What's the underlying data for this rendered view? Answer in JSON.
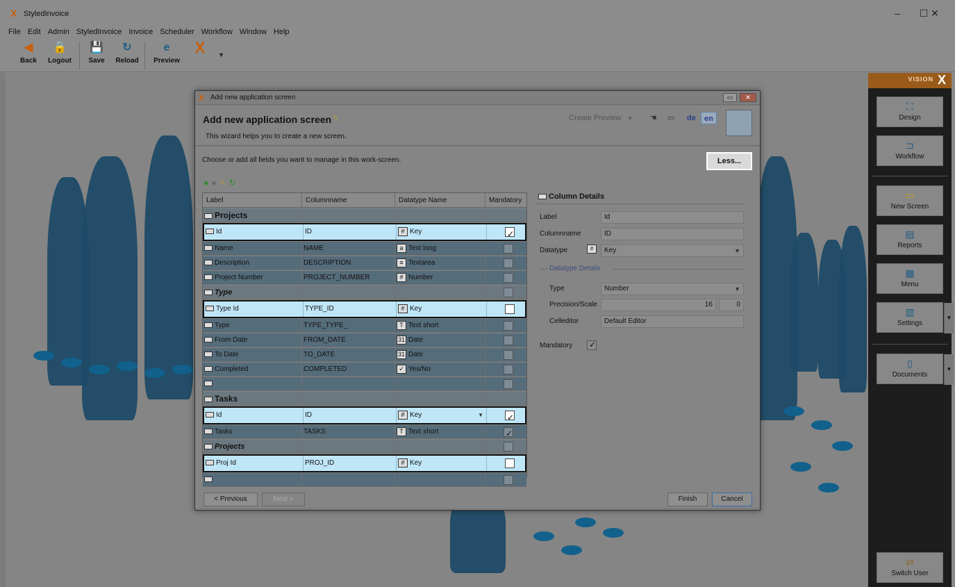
{
  "window": {
    "title": "StyledInvoice",
    "minimize": "–",
    "maximize": "☐",
    "close": "✕"
  },
  "menu": [
    "File",
    "Edit",
    "Admin",
    "StyledInvoice",
    "Invoice",
    "Scheduler",
    "Workflow",
    "Window",
    "Help"
  ],
  "toolbar": {
    "back": "Back",
    "logout": "Logout",
    "save": "Save",
    "reload": "Reload",
    "preview": "Preview"
  },
  "sidebar": {
    "brand": "VISION",
    "design": "Design",
    "workflow": "Workflow",
    "new_screen": "New Screen",
    "reports": "Reports",
    "menu": "Menu",
    "settings": "Settings",
    "documents": "Documents",
    "switch_user": "Switch User"
  },
  "dialog": {
    "window_title": "Add new application screen",
    "heading": "Add new application screen",
    "subtitle": "This wizard helps you to create a new screen.",
    "create_preview": "Create Preview",
    "lang_de": "de",
    "lang_en": "en",
    "instructions": "Choose or add all fields you want to manage in this work-screen.",
    "less_button": "Less...",
    "columns": {
      "label": "Label",
      "columnname": "Columnname",
      "datatype": "Datatype Name",
      "mandatory": "Mandatory"
    },
    "rows": [
      {
        "label": "Projects",
        "col": "",
        "dt": "",
        "dt_icon": "",
        "type": "group",
        "mand": null
      },
      {
        "label": "Id",
        "col": "ID",
        "dt": "Key",
        "dt_icon": "#",
        "type": "hl",
        "mand": true
      },
      {
        "label": "Name",
        "col": "NAME",
        "dt": "Text long",
        "dt_icon": "a",
        "type": "row",
        "mand": false
      },
      {
        "label": "Description",
        "col": "DESCRIPTION",
        "dt": "Textarea",
        "dt_icon": "≡",
        "type": "row",
        "mand": false
      },
      {
        "label": "Project Number",
        "col": "PROJECT_NUMBER",
        "dt": "Number",
        "dt_icon": "#",
        "type": "row",
        "mand": false
      },
      {
        "label": "Type",
        "col": "",
        "dt": "",
        "dt_icon": "",
        "type": "group-italic",
        "mand": false
      },
      {
        "label": "Type Id",
        "col": "TYPE_ID",
        "dt": "Key",
        "dt_icon": "#",
        "type": "hl",
        "mand": false
      },
      {
        "label": "Type",
        "col": "TYPE_TYPE_",
        "dt": "Text short",
        "dt_icon": "T",
        "type": "row",
        "mand": false
      },
      {
        "label": "From Date",
        "col": "FROM_DATE",
        "dt": "Date",
        "dt_icon": "31",
        "type": "row",
        "mand": false
      },
      {
        "label": "To Date",
        "col": "TO_DATE",
        "dt": "Date",
        "dt_icon": "31",
        "type": "row",
        "mand": false
      },
      {
        "label": "Completed",
        "col": "COMPLETED",
        "dt": "Yes/No",
        "dt_icon": "✓",
        "type": "row",
        "mand": false
      },
      {
        "label": "",
        "col": "",
        "dt": "",
        "dt_icon": "",
        "type": "row",
        "mand": false
      },
      {
        "label": "Tasks",
        "col": "",
        "dt": "",
        "dt_icon": "",
        "type": "group",
        "mand": null
      },
      {
        "label": "Id",
        "col": "ID",
        "dt": "Key",
        "dt_icon": "#",
        "type": "hl",
        "mand": true
      },
      {
        "label": "Tasks",
        "col": "TASKS",
        "dt": "Text short",
        "dt_icon": "T",
        "type": "row",
        "mand": true
      },
      {
        "label": "Projects",
        "col": "",
        "dt": "",
        "dt_icon": "",
        "type": "group-italic",
        "mand": false
      },
      {
        "label": "Proj Id",
        "col": "PROJ_ID",
        "dt": "Key",
        "dt_icon": "#",
        "type": "hl",
        "mand": false
      },
      {
        "label": "",
        "col": "",
        "dt": "",
        "dt_icon": "",
        "type": "row",
        "mand": false
      }
    ],
    "details": {
      "title": "Column Details",
      "label_label": "Label",
      "label_value": "Id",
      "columnname_label": "Columnname",
      "columnname_value": "ID",
      "datatype_label": "Datatype",
      "datatype_value": "Key",
      "datatype_details": "Datatype Details",
      "type_label": "Type",
      "type_value": "Number",
      "precision_label": "Precision/Scale",
      "precision_value": "16",
      "scale_value": "0",
      "celleditor_label": "Celleditor",
      "celleditor_value": "Default Editor",
      "mandatory_label": "Mandatory"
    },
    "previous": "< Previous",
    "next": "Next >",
    "finish": "Finish",
    "cancel": "Cancel"
  }
}
